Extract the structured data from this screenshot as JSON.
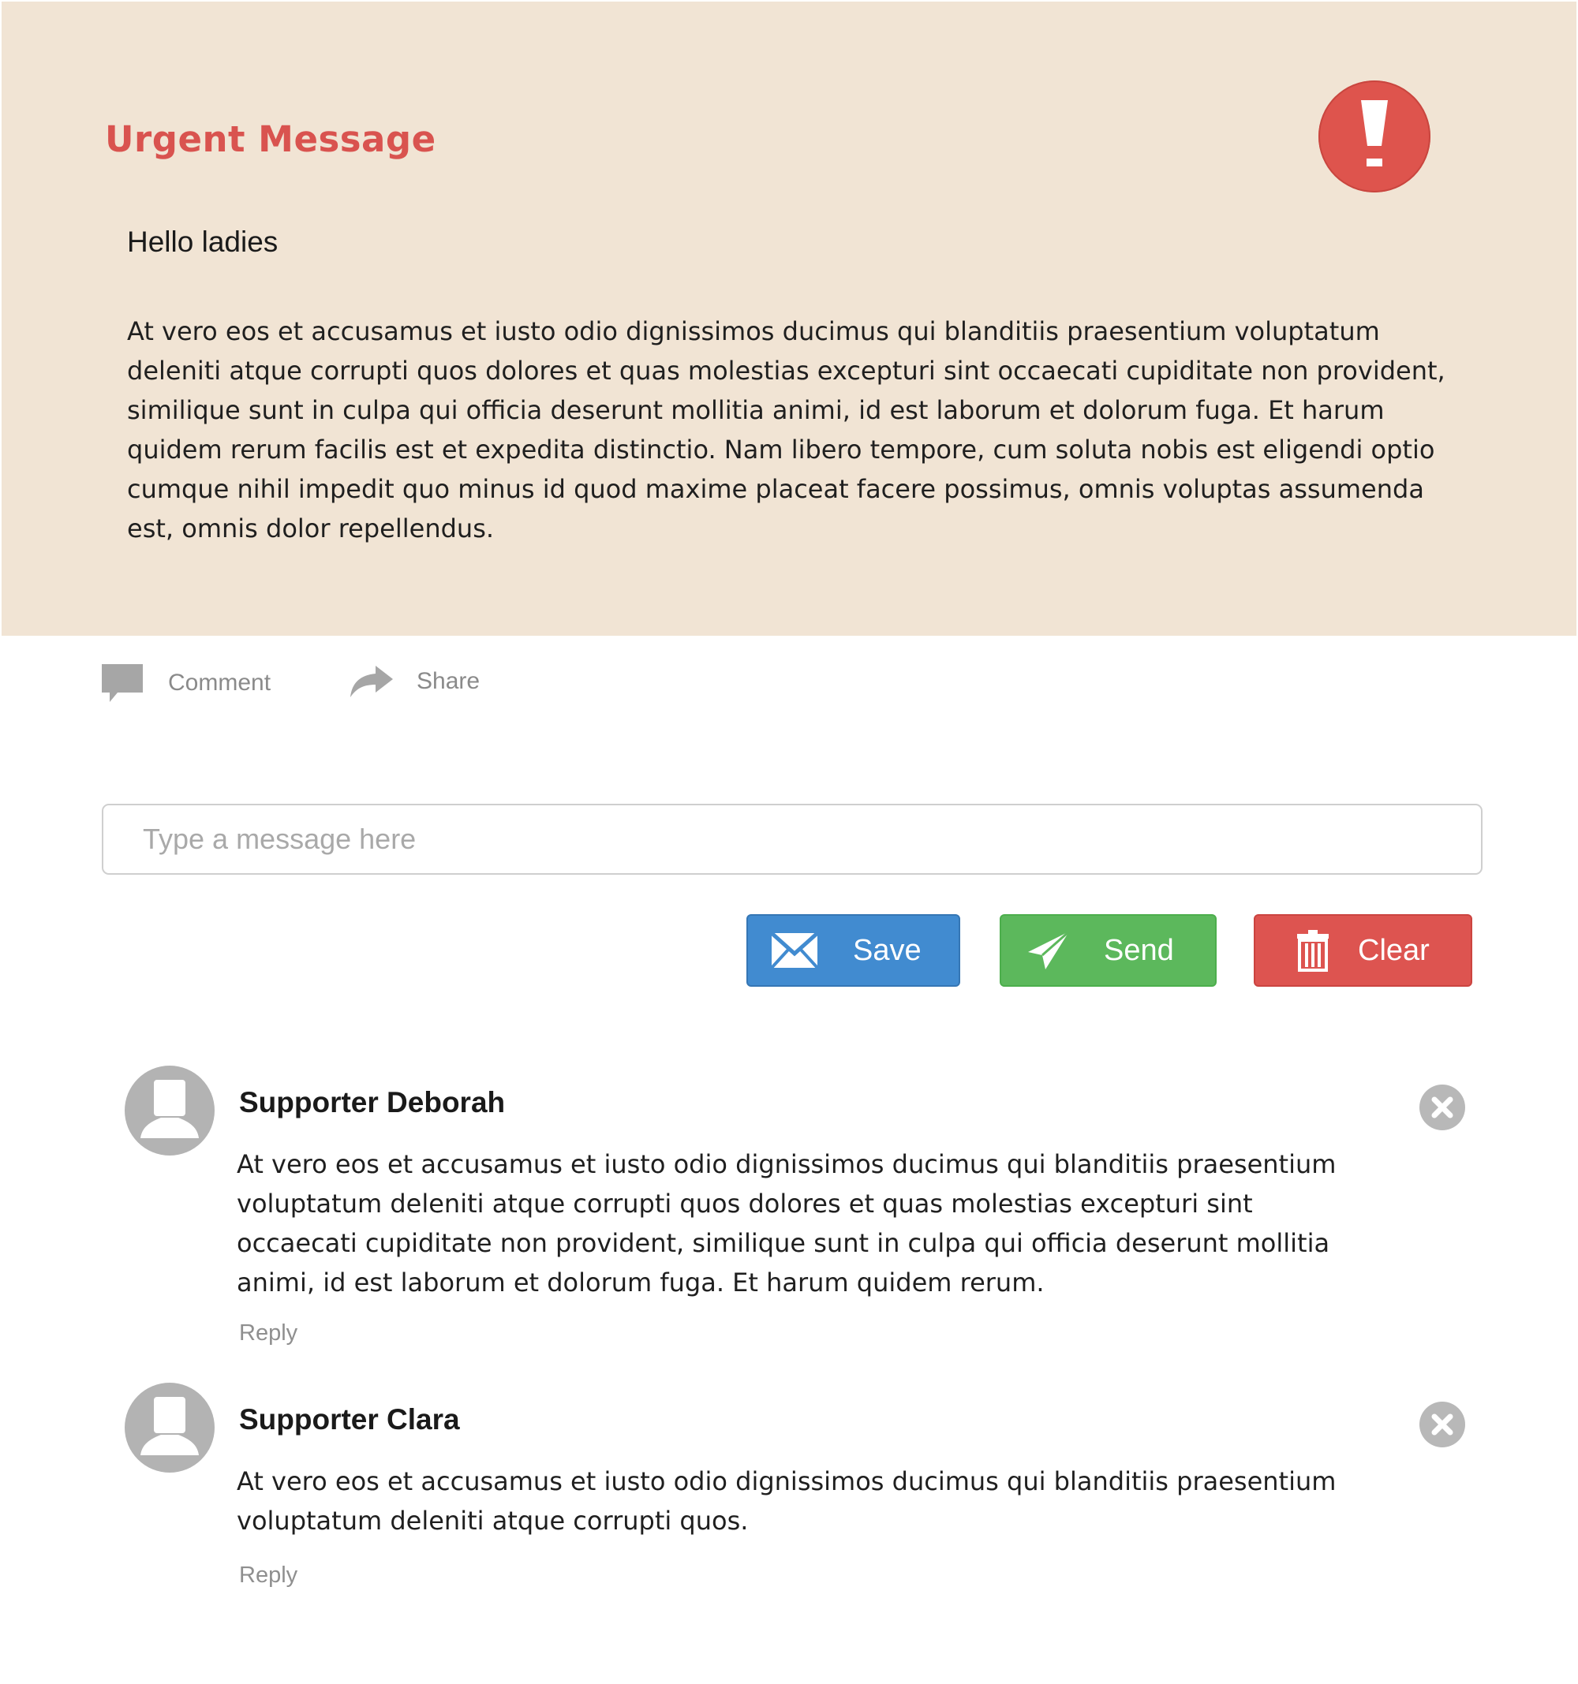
{
  "message": {
    "title": "Urgent Message",
    "alert_icon": "exclamation-icon",
    "greeting": "Hello ladies",
    "body": "At vero eos et accusamus et iusto odio dignissimos ducimus qui blanditiis praesentium voluptatum deleniti atque corrupti quos dolores et quas molestias excepturi sint occaecati cupiditate non provident, similique sunt in culpa qui officia deserunt mollitia animi, id est laborum et dolorum fuga. Et harum quidem rerum facilis est et expedita distinctio. Nam libero tempore, cum soluta nobis est eligendi optio cumque nihil impedit quo minus id quod maxime placeat facere possimus, omnis voluptas assumenda est, omnis dolor repellendus."
  },
  "actions": {
    "comment_label": "Comment",
    "comment_icon": "speech-bubble-icon",
    "share_label": "Share",
    "share_icon": "share-arrow-icon"
  },
  "composer": {
    "placeholder": "Type a message here",
    "value": ""
  },
  "buttons": {
    "save_label": "Save",
    "save_icon": "envelope-icon",
    "send_label": "Send",
    "send_icon": "paper-plane-icon",
    "clear_label": "Clear",
    "clear_icon": "trash-icon"
  },
  "comments": [
    {
      "author": "Supporter Deborah",
      "body": "At vero eos et accusamus et iusto odio dignissimos ducimus qui blanditiis praesentium voluptatum deleniti atque corrupti quos dolores et quas molestias excepturi sint occaecati cupiditate non provident, similique sunt in culpa qui officia deserunt mollitia animi, id est laborum et dolorum fuga. Et harum quidem rerum.",
      "reply_label": "Reply"
    },
    {
      "author": "Supporter Clara",
      "body": "At vero eos et accusamus et iusto odio dignissimos ducimus qui blanditiis praesentium voluptatum deleniti atque corrupti quos.",
      "reply_label": "Reply"
    }
  ],
  "colors": {
    "card_background": "#f1e4d4",
    "urgent_red": "#d9534f",
    "save_blue": "#418bd0",
    "send_green": "#5cb85c",
    "clear_red": "#dd5450",
    "muted_gray": "#8a8a8a"
  }
}
